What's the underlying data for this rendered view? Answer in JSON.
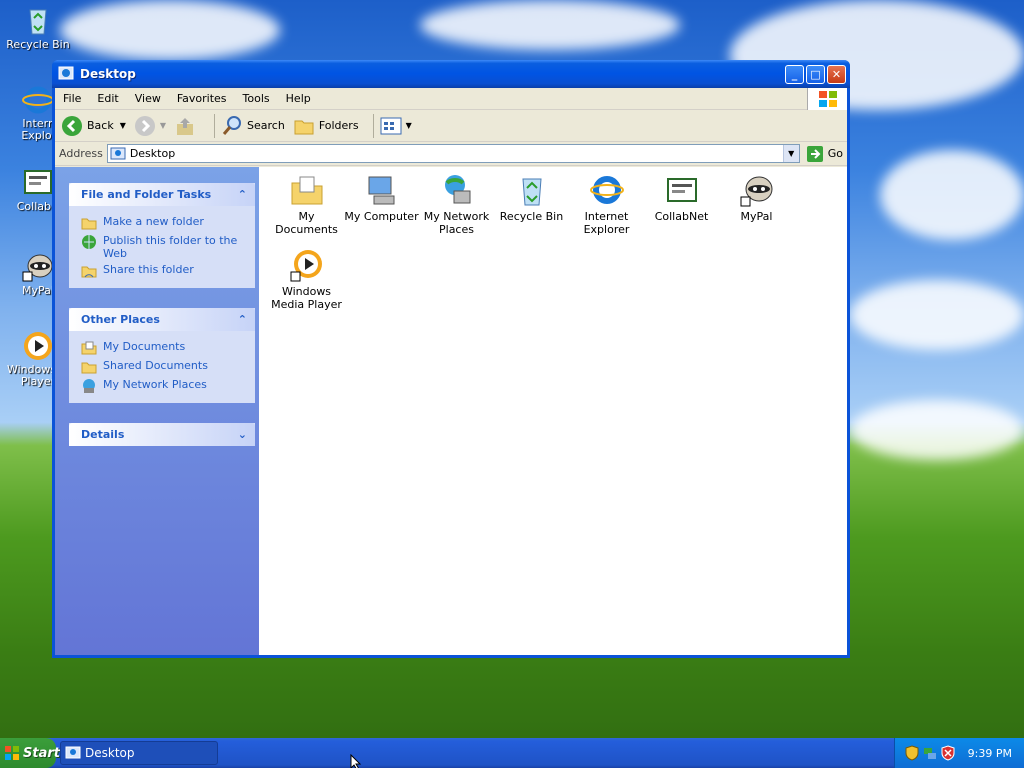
{
  "desktop": {
    "icons": [
      {
        "label": "Recycle Bin",
        "icon": "recycle-bin-icon"
      },
      {
        "label": "Interne Explore",
        "icon": "internet-explorer-icon"
      },
      {
        "label": "CollabN",
        "icon": "collabnet-icon"
      },
      {
        "label": "MyPal",
        "icon": "mypal-icon"
      },
      {
        "label": "Windows M Player",
        "icon": "windows-media-player-icon"
      }
    ]
  },
  "window": {
    "title": "Desktop",
    "menu": [
      "File",
      "Edit",
      "View",
      "Favorites",
      "Tools",
      "Help"
    ],
    "toolbar": {
      "back": "Back",
      "search": "Search",
      "folders": "Folders"
    },
    "address": {
      "label": "Address",
      "value": "Desktop",
      "go": "Go"
    },
    "sidebar": {
      "file_tasks": {
        "title": "File and Folder Tasks",
        "items": [
          "Make a new folder",
          "Publish this folder to the Web",
          "Share this folder"
        ]
      },
      "other_places": {
        "title": "Other Places",
        "items": [
          "My Documents",
          "Shared Documents",
          "My Network Places"
        ]
      },
      "details": {
        "title": "Details"
      }
    },
    "items": [
      {
        "label": "My Documents",
        "icon": "my-documents-icon"
      },
      {
        "label": "My Computer",
        "icon": "my-computer-icon"
      },
      {
        "label": "My Network Places",
        "icon": "my-network-places-icon"
      },
      {
        "label": "Recycle Bin",
        "icon": "recycle-bin-icon"
      },
      {
        "label": "Internet Explorer",
        "icon": "internet-explorer-icon"
      },
      {
        "label": "CollabNet",
        "icon": "collabnet-icon"
      },
      {
        "label": "MyPal",
        "icon": "mypal-icon"
      },
      {
        "label": "Windows Media Player",
        "icon": "windows-media-player-icon"
      }
    ]
  },
  "taskbar": {
    "start": "Start",
    "task": "Desktop",
    "clock": "9:39 PM"
  },
  "colors": {
    "titlebar": "#0054e3",
    "taskbar": "#245edb",
    "start": "#2d8a2d",
    "link": "#215dc6"
  }
}
